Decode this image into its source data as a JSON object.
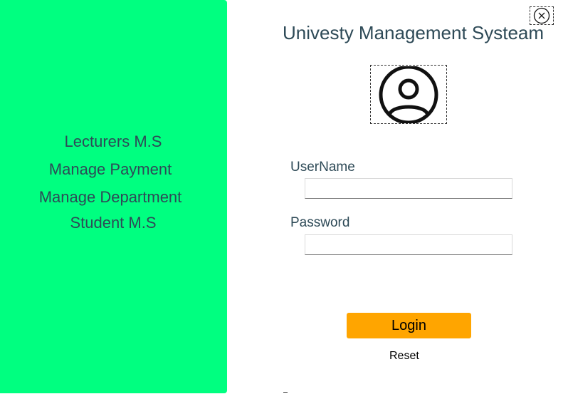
{
  "app": {
    "title": "Univesty Management Systeam"
  },
  "sidebar": {
    "background_color": "#00ff80",
    "items": [
      {
        "label": "Lecturers M.S"
      },
      {
        "label": "Manage Payment"
      },
      {
        "label": "Manage Department"
      },
      {
        "label": "Student M.S"
      }
    ]
  },
  "icons": {
    "close": "close-circle-icon",
    "avatar": "user-avatar-icon"
  },
  "form": {
    "username_label": "UserName",
    "username_value": "",
    "password_label": "Password",
    "password_value": "",
    "login_label": "Login",
    "reset_label": "Reset",
    "login_color": "#ffa500"
  }
}
